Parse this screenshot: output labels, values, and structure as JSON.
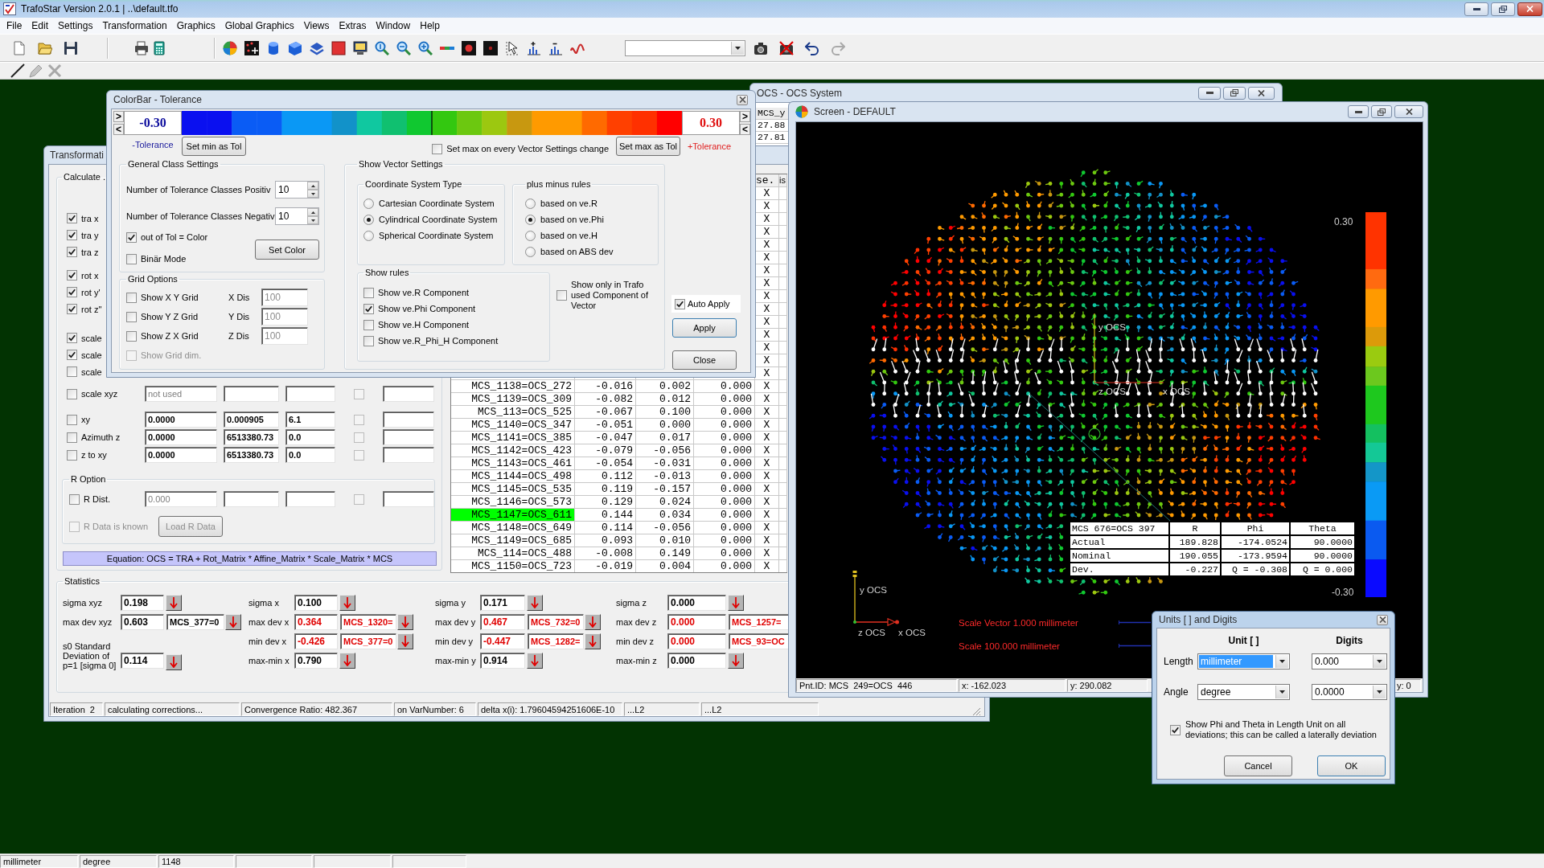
{
  "app": {
    "title": "TrafoStar Version 2.0.1 | ..\\default.tfo",
    "menu": [
      "File",
      "Edit",
      "Settings",
      "Transformation",
      "Graphics",
      "Global Graphics",
      "Views",
      "Extras",
      "Window",
      "Help"
    ]
  },
  "status_bar": [
    "millimeter",
    "degree",
    "1148"
  ],
  "ocs_window": {
    "title": "OCS - OCS System",
    "column": "MCS_y",
    "cells": [
      "27.88",
      "27.81"
    ]
  },
  "transformation": {
    "title": "Transformati",
    "calculate": {
      "label": "Calculate ..",
      "options": [
        [
          {
            "label": "tra x",
            "checked": true
          },
          {
            "label": "tra y",
            "checked": true
          },
          {
            "label": "tra z",
            "checked": true
          }
        ],
        [
          {
            "label": "rot x",
            "checked": true
          },
          {
            "label": "rot y'",
            "checked": true
          },
          {
            "label": "rot z''",
            "checked": true
          }
        ],
        [
          {
            "label": "scale",
            "checked": true
          },
          {
            "label": "scale",
            "checked": true
          },
          {
            "label": "scale",
            "checked": false
          }
        ]
      ],
      "params": [
        [
          {
            "label": "scale xyz",
            "checked": false,
            "disabled": true,
            "fields": [
              "not used"
            ],
            "option_checked": false
          }
        ],
        [
          {
            "label": "xy",
            "checked": false,
            "disabled": false,
            "fields": [
              "0.0000",
              "0.000905",
              "6.1"
            ],
            "option_checked": false
          },
          {
            "label": "Azimuth z",
            "checked": false,
            "disabled": false,
            "fields": [
              "0.0000",
              "6513380.73",
              "0.0"
            ],
            "option_checked": false
          },
          {
            "label": "z to xy",
            "checked": false,
            "disabled": false,
            "fields": [
              "0.0000",
              "6513380.73",
              "0.0"
            ],
            "option_checked": false
          }
        ]
      ],
      "r_option": {
        "label": "R Option",
        "dist": {
          "label": "R Dist.",
          "checked": false,
          "disabled": true,
          "fields": [
            "0.000"
          ],
          "option_checked": false
        },
        "known": {
          "label": "R Data is known",
          "checked": false,
          "disabled": true
        },
        "load": {
          "label": "Load R Data",
          "disabled": true
        }
      },
      "equation": "Equation: OCS = TRA + Rot_Matrix * Affine_Matrix * Scale_Matrix * MCS"
    },
    "table": {
      "headers": {
        "column_5": "se.",
        "column_6": "is"
      },
      "rows": [
        {
          "column_5": "X"
        },
        {
          "column_5": "X"
        },
        {
          "column_5": "X"
        },
        {
          "column_5": "X"
        },
        {
          "column_5": "X"
        },
        {
          "column_5": "X"
        },
        {
          "column_5": "X"
        },
        {
          "column_5": "X"
        },
        {
          "column_5": "X"
        },
        {
          "column_5": "X"
        },
        {
          "column_5": "X"
        },
        {
          "column_5": "X"
        },
        {
          "column_5": "X"
        },
        {
          "column_5": "X"
        },
        {
          "column_5": "X"
        },
        {
          "column_1": "MCS_1138=OCS_272",
          "column_2": "-0.016",
          "column_3": "0.002",
          "column_4": "0.000",
          "column_5": "X",
          "selected": false
        },
        {
          "column_1": "MCS_1139=OCS_309",
          "column_2": "-0.082",
          "column_3": "0.012",
          "column_4": "0.000",
          "column_5": "X",
          "selected": false
        },
        {
          "column_1": "MCS_113=OCS_525",
          "column_2": "-0.067",
          "column_3": "0.100",
          "column_4": "0.000",
          "column_5": "X",
          "selected": false
        },
        {
          "column_1": "MCS_1140=OCS_347",
          "column_2": "-0.051",
          "column_3": "0.000",
          "column_4": "0.000",
          "column_5": "X",
          "selected": false
        },
        {
          "column_1": "MCS_1141=OCS_385",
          "column_2": "-0.047",
          "column_3": "0.017",
          "column_4": "0.000",
          "column_5": "X",
          "selected": false
        },
        {
          "column_1": "MCS_1142=OCS_423",
          "column_2": "-0.079",
          "column_3": "-0.056",
          "column_4": "0.000",
          "column_5": "X",
          "selected": false
        },
        {
          "column_1": "MCS_1143=OCS_461",
          "column_2": "-0.054",
          "column_3": "-0.031",
          "column_4": "0.000",
          "column_5": "X",
          "selected": false
        },
        {
          "column_1": "MCS_1144=OCS_498",
          "column_2": "0.112",
          "column_3": "-0.013",
          "column_4": "0.000",
          "column_5": "X",
          "selected": false
        },
        {
          "column_1": "MCS_1145=OCS_535",
          "column_2": "0.119",
          "column_3": "-0.157",
          "column_4": "0.000",
          "column_5": "X",
          "selected": false
        },
        {
          "column_1": "MCS_1146=OCS_573",
          "column_2": "0.129",
          "column_3": "0.024",
          "column_4": "0.000",
          "column_5": "X",
          "selected": false
        },
        {
          "column_1": "MCS_1147=OCS_611",
          "column_2": "0.144",
          "column_3": "0.034",
          "column_4": "0.000",
          "column_5": "X",
          "selected": true
        },
        {
          "column_1": "MCS_1148=OCS_649",
          "column_2": "0.114",
          "column_3": "-0.056",
          "column_4": "0.000",
          "column_5": "X",
          "selected": false
        },
        {
          "column_1": "MCS_1149=OCS_685",
          "column_2": "0.093",
          "column_3": "0.010",
          "column_4": "0.000",
          "column_5": "X",
          "selected": false
        },
        {
          "column_1": "MCS_114=OCS_488",
          "column_2": "-0.008",
          "column_3": "0.149",
          "column_4": "0.000",
          "column_5": "X",
          "selected": false
        },
        {
          "column_1": "MCS_1150=OCS_723",
          "column_2": "-0.019",
          "column_3": "0.004",
          "column_4": "0.000",
          "column_5": "X",
          "selected": false
        }
      ]
    },
    "statistics": {
      "label": "Statistics",
      "columns": [
        [
          {
            "kind": "sigma",
            "label": "sigma xyz",
            "value": "0.198",
            "flagged": false,
            "pick_button": true
          },
          {
            "kind": "dev",
            "label": "max dev xyz",
            "value": "0.603",
            "point": "MCS_377=0",
            "flagged": false,
            "pick_button": true
          },
          {
            "kind": "s0",
            "label": "s0 Standard Deviation of p=1 [sigma 0]",
            "value": "0.114",
            "flagged": false,
            "pick_button": true
          }
        ],
        [
          {
            "kind": "sigma",
            "label": "sigma x",
            "value": "0.100",
            "flagged": false,
            "pick_button": true
          },
          {
            "kind": "dev",
            "label": "max dev x",
            "value": "0.364",
            "point": "MCS_1320=",
            "flagged": true,
            "pick_button": true
          },
          {
            "kind": "dev",
            "label": "min dev x",
            "value": "-0.426",
            "point": "MCS_377=0",
            "flagged": true,
            "pick_button": true
          },
          {
            "kind": "sigma",
            "label": "max-min x",
            "value": "0.790",
            "flagged": false,
            "pick_button": true
          }
        ],
        [
          {
            "kind": "sigma",
            "label": "sigma y",
            "value": "0.171",
            "flagged": false,
            "pick_button": true
          },
          {
            "kind": "dev",
            "label": "max dev y",
            "value": "0.467",
            "point": "MCS_732=0",
            "flagged": true,
            "pick_button": true
          },
          {
            "kind": "dev",
            "label": "min dev y",
            "value": "-0.447",
            "point": "MCS_1282=",
            "flagged": true,
            "pick_button": true
          },
          {
            "kind": "sigma",
            "label": "max-min y",
            "value": "0.914",
            "flagged": false,
            "pick_button": true
          }
        ],
        [
          {
            "kind": "sigma",
            "label": "sigma z",
            "value": "0.000",
            "flagged": false,
            "pick_button": true
          },
          {
            "kind": "dev",
            "label": "max dev z",
            "value": "0.000",
            "point": "MCS_1257=",
            "flagged": true,
            "pick_button": false
          },
          {
            "kind": "dev",
            "label": "min dev z",
            "value": "0.000",
            "point": "MCS_93=OC",
            "flagged": true,
            "pick_button": false
          },
          {
            "kind": "sigma",
            "label": "max-min z",
            "value": "0.000",
            "flagged": false,
            "pick_button": true
          }
        ]
      ]
    },
    "status": [
      "Iteration  2",
      "calculating corrections...",
      "Convergence Ratio: 482.367",
      "on VarNumber: 6",
      "delta x(i): 1.79604594251606E-10",
      "...L2",
      "...L2"
    ]
  },
  "colorbar": {
    "title": "ColorBar - Tolerance",
    "min": {
      "steps": [
        ">",
        "<"
      ],
      "value": "-0.30",
      "label": "-Tolerance",
      "button": "Set min as Tol"
    },
    "max": {
      "steps": [
        ">",
        "<"
      ],
      "value": "0.30",
      "label": "+Tolerance",
      "button": "Set max as Tol"
    },
    "max_on_change": {
      "label": "Set max on every Vector Settings change",
      "checked": false
    },
    "general": {
      "title": "General Class Settings",
      "spins": [
        {
          "label": "Number of Tolerance Classes Positiv",
          "value": "10"
        },
        {
          "label": "Number of Tolerance Classes Negativ",
          "value": "10"
        }
      ],
      "checks": [
        {
          "label": "out of Tol = Color",
          "checked": true
        },
        {
          "label": "Binär Mode",
          "checked": false
        }
      ],
      "button": "Set Color"
    },
    "grid": {
      "title": "Grid Options",
      "rows": [
        {
          "label": "Show X Y Grid",
          "checked": false,
          "dis_label": "X Dis",
          "dis_value": "100",
          "field_disabled": true
        },
        {
          "label": "Show Y Z Grid",
          "checked": false,
          "dis_label": "Y Dis",
          "dis_value": "100",
          "field_disabled": true
        },
        {
          "label": "Show Z X Grid",
          "checked": false,
          "dis_label": "Z Dis",
          "dis_value": "100",
          "field_disabled": true
        }
      ],
      "dim": {
        "label": "Show Grid dim.",
        "checked": false,
        "disabled": true
      }
    },
    "vector": {
      "title": "Show Vector Settings",
      "coord": {
        "title": "Coordinate System Type",
        "options": [
          {
            "label": "Cartesian Coordinate System",
            "selected": false
          },
          {
            "label": "Cylindrical Coordinate System",
            "selected": true
          },
          {
            "label": "Spherical Coordinate System",
            "selected": false
          }
        ]
      },
      "plus_minus": {
        "title": "plus minus rules",
        "options": [
          {
            "label": "based on ve.R",
            "selected": false
          },
          {
            "label": "based on ve.Phi",
            "selected": true
          },
          {
            "label": "based on ve.H",
            "selected": false
          },
          {
            "label": "based on ABS dev",
            "selected": false
          }
        ]
      },
      "rules": {
        "title": "Show rules",
        "options": [
          {
            "label": "Show ve.R Component",
            "checked": false
          },
          {
            "label": "Show ve.Phi Component",
            "checked": true
          },
          {
            "label": "Show ve.H Component",
            "checked": false
          },
          {
            "label": "Show ve.R_Phi_H Component",
            "checked": false
          }
        ]
      },
      "trafo_only": {
        "label": "Show only in Trafo used Component of Vector",
        "checked": false
      }
    },
    "auto_apply": {
      "label": "Auto Apply",
      "checked": true
    },
    "buttons": [
      "Apply",
      "Close"
    ]
  },
  "screen": {
    "title": "Screen - DEFAULT",
    "legend": {
      "max": "0.30",
      "min": "-0.30"
    },
    "center_axes": {
      "y": "y OCS",
      "z": "z OCS",
      "x": "x OCS"
    },
    "corner_axes": {
      "y": "y OCS",
      "z": "z OCS",
      "x": "x OCS"
    },
    "point_table": {
      "header": [
        "MCS 676=OCS 397",
        "R",
        "Phi",
        "Theta"
      ],
      "rows": [
        [
          "Actual",
          "189.828",
          "-174.0524",
          "90.0000"
        ],
        [
          "Nominal",
          "190.055",
          "-173.9594",
          "90.0000"
        ],
        [
          "Dev.",
          "-0.227",
          "Q = -0.308",
          "Q = 0.000"
        ]
      ]
    },
    "scale_notes": [
      "Scale Vector 1.000 millimeter",
      "Scale 100.000 millimeter"
    ],
    "status": [
      "Pnt.ID: MCS  249=OCS  446",
      "x: -162.023",
      "y: 290.082",
      "y: 0"
    ]
  },
  "units": {
    "title": "Units [ ] and Digits",
    "headers": [
      "Unit [ ]",
      "Digits"
    ],
    "rows": [
      {
        "label": "Length",
        "unit": "millimeter",
        "digits": "0.000",
        "focused": true
      },
      {
        "label": "Angle",
        "unit": "degree",
        "digits": "0.0000",
        "focused": false
      }
    ],
    "option": {
      "label": "Show Phi and Theta in Length Unit on all deviations; this can be called a laterally deviation",
      "checked": true
    },
    "buttons": [
      "Cancel",
      "OK"
    ]
  }
}
